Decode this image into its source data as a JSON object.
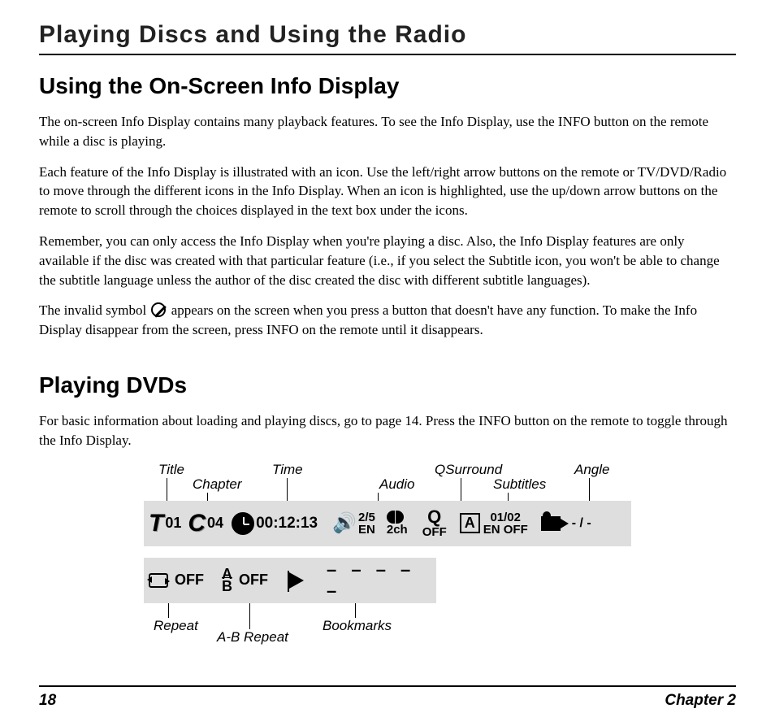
{
  "chapter_title": "Playing Discs and Using the Radio",
  "section1": {
    "title": "Using the On-Screen Info Display",
    "p1": "The on-screen Info Display contains many playback features. To see the Info Display, use the INFO button on the remote while a disc is playing.",
    "p2": "Each feature of the Info Display is illustrated with an icon. Use the left/right arrow buttons on the remote or TV/DVD/Radio to move through the different icons in the Info Display. When an icon is highlighted, use the up/down arrow buttons on the remote to scroll through the choices displayed in the text box under the icons.",
    "p3": "Remember, you can only access the Info Display when you're playing a disc. Also, the Info Display features are only available if the disc was created with that particular feature (i.e., if you select the Subtitle icon, you won't be able to change the subtitle language unless the author of the disc created the disc with different subtitle languages).",
    "p4a": "The invalid symbol ",
    "p4b": " appears on the screen when you press a button that doesn't have any function.  To make the Info Display disappear from the screen, press INFO on the remote until it disappears."
  },
  "section2": {
    "title": "Playing DVDs",
    "p1": "For basic information about loading and playing discs, go to page 14. Press the INFO button on the remote to toggle through the Info Display."
  },
  "diagram": {
    "labels_top": {
      "title": "Title",
      "chapter": "Chapter",
      "time": "Time",
      "audio": "Audio",
      "qsurround": "QSurround",
      "subtitles": "Subtitles",
      "angle": "Angle"
    },
    "bar1": {
      "title_letter": "T",
      "title_num": "01",
      "chapter_letter": "C",
      "chapter_num": "04",
      "time": "00:12:13",
      "audio_top": "2/5",
      "audio_bot": "EN",
      "dolby": "2ch",
      "q_letter": "Q",
      "q_state": "OFF",
      "sub_box": "A",
      "sub_top": "01/02",
      "sub_bot": "EN OFF",
      "angle": "- / -"
    },
    "bar2": {
      "repeat": "OFF",
      "ab_top": "A",
      "ab_bot": "B",
      "ab_state": "OFF",
      "bookmarks": "– – – – –"
    },
    "labels_bot": {
      "repeat": "Repeat",
      "ab_repeat": "A-B Repeat",
      "bookmarks": "Bookmarks"
    }
  },
  "footer": {
    "page": "18",
    "chapter": "Chapter 2"
  }
}
